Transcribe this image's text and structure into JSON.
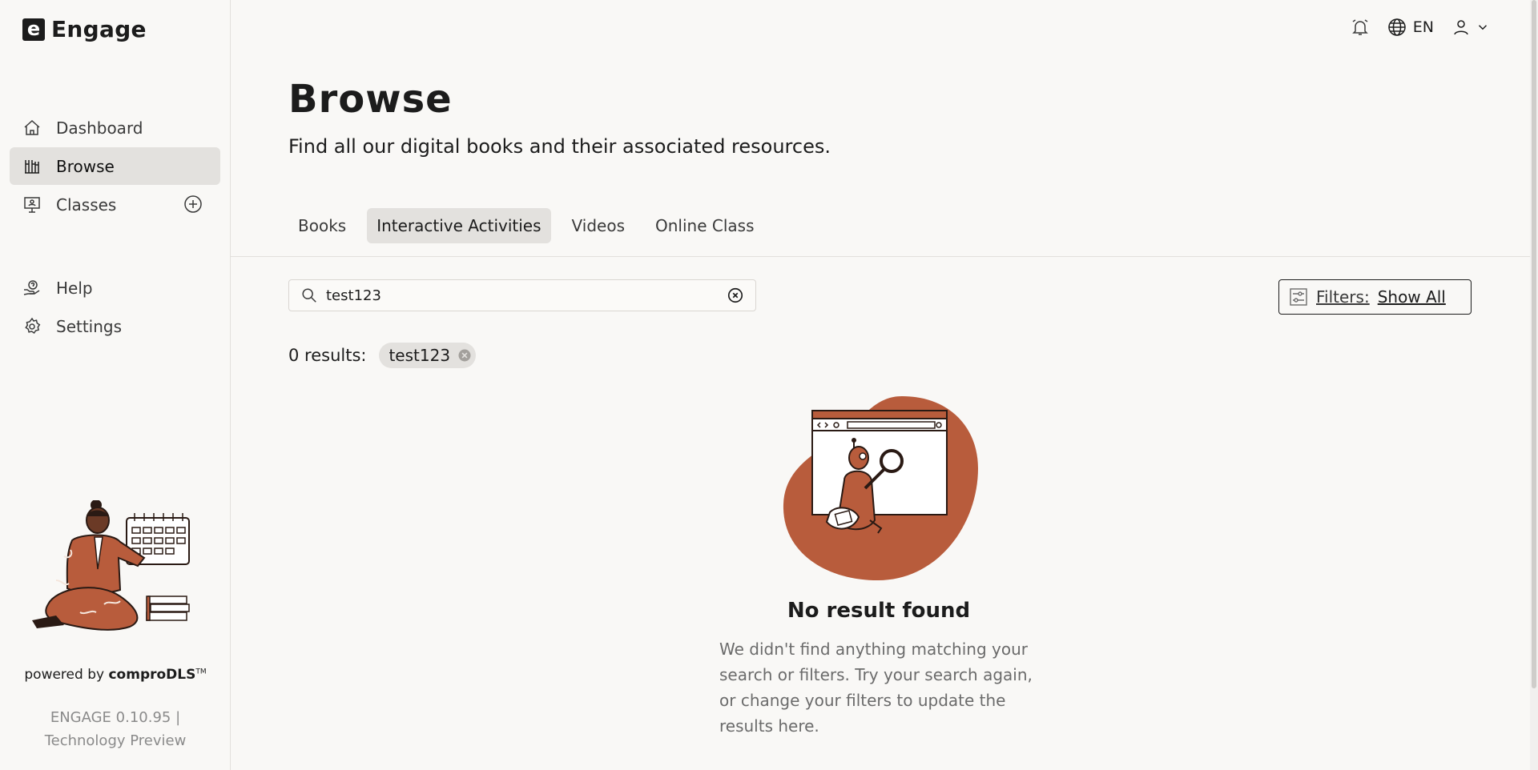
{
  "app": {
    "logo_letter": "e",
    "name": "Engage"
  },
  "sidebar": {
    "items": [
      {
        "label": "Dashboard",
        "icon": "home-icon"
      },
      {
        "label": "Browse",
        "icon": "browse-icon",
        "active": true
      },
      {
        "label": "Classes",
        "icon": "classes-icon",
        "action_icon": "add-circle-icon"
      },
      {
        "label": "Help",
        "icon": "help-icon"
      },
      {
        "label": "Settings",
        "icon": "gear-icon"
      }
    ],
    "powered_by_prefix": "powered by ",
    "powered_by_brand": "comproDLS",
    "trademark": "TM",
    "version_line1": "ENGAGE 0.10.95 |",
    "version_line2": "Technology Preview"
  },
  "topbar": {
    "language": "EN"
  },
  "main": {
    "title": "Browse",
    "subtitle": "Find all our digital books and their associated resources.",
    "tabs": [
      {
        "label": "Books"
      },
      {
        "label": "Interactive Activities",
        "active": true
      },
      {
        "label": "Videos"
      },
      {
        "label": "Online Class"
      }
    ],
    "search": {
      "value": "test123",
      "placeholder": "Search"
    },
    "filters": {
      "label": "Filters:",
      "value": "Show All"
    },
    "results": {
      "count_label": "0 results:",
      "chip": "test123"
    },
    "empty": {
      "title": "No result found",
      "description": "We didn't find anything matching your search or filters. Try your search again, or change your filters to update the results here."
    }
  },
  "colors": {
    "accent": "#b85c3c",
    "background": "#f9f8f6",
    "active_bg": "#e3e1de"
  }
}
